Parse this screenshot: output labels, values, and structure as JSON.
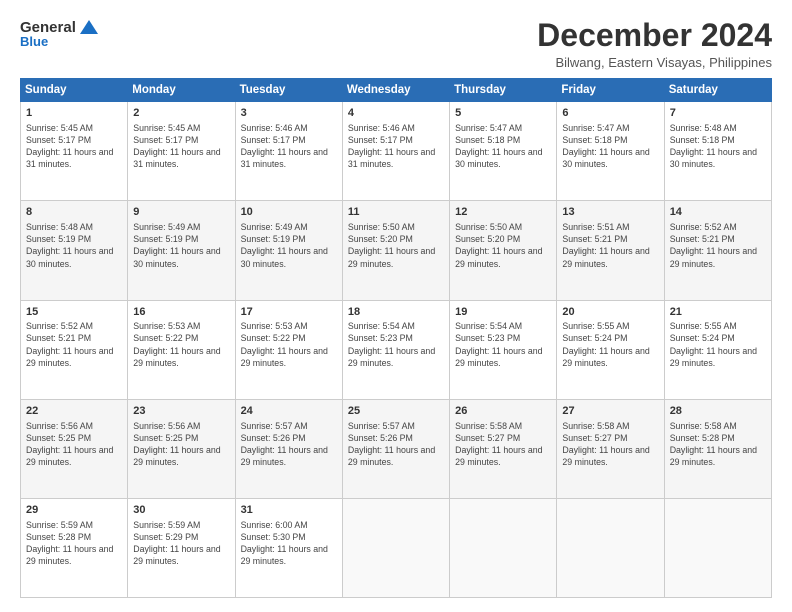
{
  "logo": {
    "general": "General",
    "blue": "Blue"
  },
  "header": {
    "month": "December 2024",
    "location": "Bilwang, Eastern Visayas, Philippines"
  },
  "weekdays": [
    "Sunday",
    "Monday",
    "Tuesday",
    "Wednesday",
    "Thursday",
    "Friday",
    "Saturday"
  ],
  "weeks": [
    [
      {
        "day": "1",
        "sunrise": "5:45 AM",
        "sunset": "5:17 PM",
        "daylight": "11 hours and 31 minutes."
      },
      {
        "day": "2",
        "sunrise": "5:45 AM",
        "sunset": "5:17 PM",
        "daylight": "11 hours and 31 minutes."
      },
      {
        "day": "3",
        "sunrise": "5:46 AM",
        "sunset": "5:17 PM",
        "daylight": "11 hours and 31 minutes."
      },
      {
        "day": "4",
        "sunrise": "5:46 AM",
        "sunset": "5:17 PM",
        "daylight": "11 hours and 31 minutes."
      },
      {
        "day": "5",
        "sunrise": "5:47 AM",
        "sunset": "5:18 PM",
        "daylight": "11 hours and 30 minutes."
      },
      {
        "day": "6",
        "sunrise": "5:47 AM",
        "sunset": "5:18 PM",
        "daylight": "11 hours and 30 minutes."
      },
      {
        "day": "7",
        "sunrise": "5:48 AM",
        "sunset": "5:18 PM",
        "daylight": "11 hours and 30 minutes."
      }
    ],
    [
      {
        "day": "8",
        "sunrise": "5:48 AM",
        "sunset": "5:19 PM",
        "daylight": "11 hours and 30 minutes."
      },
      {
        "day": "9",
        "sunrise": "5:49 AM",
        "sunset": "5:19 PM",
        "daylight": "11 hours and 30 minutes."
      },
      {
        "day": "10",
        "sunrise": "5:49 AM",
        "sunset": "5:19 PM",
        "daylight": "11 hours and 30 minutes."
      },
      {
        "day": "11",
        "sunrise": "5:50 AM",
        "sunset": "5:20 PM",
        "daylight": "11 hours and 29 minutes."
      },
      {
        "day": "12",
        "sunrise": "5:50 AM",
        "sunset": "5:20 PM",
        "daylight": "11 hours and 29 minutes."
      },
      {
        "day": "13",
        "sunrise": "5:51 AM",
        "sunset": "5:21 PM",
        "daylight": "11 hours and 29 minutes."
      },
      {
        "day": "14",
        "sunrise": "5:52 AM",
        "sunset": "5:21 PM",
        "daylight": "11 hours and 29 minutes."
      }
    ],
    [
      {
        "day": "15",
        "sunrise": "5:52 AM",
        "sunset": "5:21 PM",
        "daylight": "11 hours and 29 minutes."
      },
      {
        "day": "16",
        "sunrise": "5:53 AM",
        "sunset": "5:22 PM",
        "daylight": "11 hours and 29 minutes."
      },
      {
        "day": "17",
        "sunrise": "5:53 AM",
        "sunset": "5:22 PM",
        "daylight": "11 hours and 29 minutes."
      },
      {
        "day": "18",
        "sunrise": "5:54 AM",
        "sunset": "5:23 PM",
        "daylight": "11 hours and 29 minutes."
      },
      {
        "day": "19",
        "sunrise": "5:54 AM",
        "sunset": "5:23 PM",
        "daylight": "11 hours and 29 minutes."
      },
      {
        "day": "20",
        "sunrise": "5:55 AM",
        "sunset": "5:24 PM",
        "daylight": "11 hours and 29 minutes."
      },
      {
        "day": "21",
        "sunrise": "5:55 AM",
        "sunset": "5:24 PM",
        "daylight": "11 hours and 29 minutes."
      }
    ],
    [
      {
        "day": "22",
        "sunrise": "5:56 AM",
        "sunset": "5:25 PM",
        "daylight": "11 hours and 29 minutes."
      },
      {
        "day": "23",
        "sunrise": "5:56 AM",
        "sunset": "5:25 PM",
        "daylight": "11 hours and 29 minutes."
      },
      {
        "day": "24",
        "sunrise": "5:57 AM",
        "sunset": "5:26 PM",
        "daylight": "11 hours and 29 minutes."
      },
      {
        "day": "25",
        "sunrise": "5:57 AM",
        "sunset": "5:26 PM",
        "daylight": "11 hours and 29 minutes."
      },
      {
        "day": "26",
        "sunrise": "5:58 AM",
        "sunset": "5:27 PM",
        "daylight": "11 hours and 29 minutes."
      },
      {
        "day": "27",
        "sunrise": "5:58 AM",
        "sunset": "5:27 PM",
        "daylight": "11 hours and 29 minutes."
      },
      {
        "day": "28",
        "sunrise": "5:58 AM",
        "sunset": "5:28 PM",
        "daylight": "11 hours and 29 minutes."
      }
    ],
    [
      {
        "day": "29",
        "sunrise": "5:59 AM",
        "sunset": "5:28 PM",
        "daylight": "11 hours and 29 minutes."
      },
      {
        "day": "30",
        "sunrise": "5:59 AM",
        "sunset": "5:29 PM",
        "daylight": "11 hours and 29 minutes."
      },
      {
        "day": "31",
        "sunrise": "6:00 AM",
        "sunset": "5:30 PM",
        "daylight": "11 hours and 29 minutes."
      },
      null,
      null,
      null,
      null
    ]
  ],
  "labels": {
    "sunrise": "Sunrise:",
    "sunset": "Sunset:",
    "daylight": "Daylight:"
  }
}
